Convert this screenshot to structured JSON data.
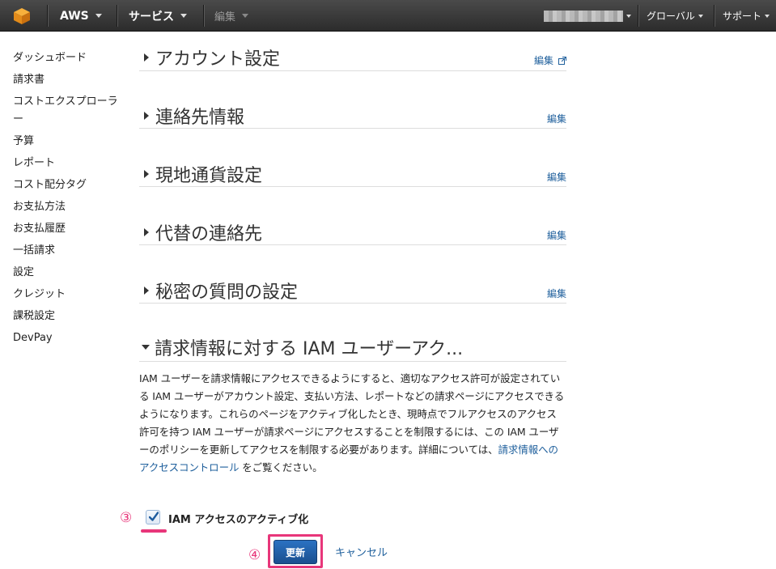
{
  "nav": {
    "brand": "AWS",
    "services": "サービス",
    "edit": "編集",
    "region": "グローバル",
    "support": "サポート"
  },
  "sidebar": {
    "items": [
      {
        "label": "ダッシュボード"
      },
      {
        "label": "請求書"
      },
      {
        "label": "コストエクスプローラー"
      },
      {
        "label": "予算"
      },
      {
        "label": "レポート"
      },
      {
        "label": "コスト配分タグ"
      },
      {
        "label": "お支払方法"
      },
      {
        "label": "お支払履歴"
      },
      {
        "label": "一括請求"
      },
      {
        "label": "設定"
      },
      {
        "label": "クレジット"
      },
      {
        "label": "課税設定"
      },
      {
        "label": "DevPay"
      }
    ]
  },
  "sections": [
    {
      "title": "アカウント設定",
      "edit": "編集"
    },
    {
      "title": "連絡先情報",
      "edit": "編集"
    },
    {
      "title": "現地通貨設定",
      "edit": "編集"
    },
    {
      "title": "代替の連絡先",
      "edit": "編集"
    },
    {
      "title": "秘密の質問の設定",
      "edit": "編集"
    }
  ],
  "iam": {
    "title": "請求情報に対する IAM ユーザーアク...",
    "text_before": "IAM ユーザーを請求情報にアクセスできるようにすると、適切なアクセス許可が設定されている IAM ユーザーがアカウント設定、支払い方法、レポートなどの請求ページにアクセスできるようになります。これらのページをアクティブ化したとき、現時点でフルアクセスのアクセス許可を持つ IAM ユーザーが請求ページにアクセスすることを制限するには、この IAM ユーザーのポリシーを更新してアクセスを制限する必要があります。詳細については、",
    "link": "請求情報へのアクセスコントロール",
    "text_after": " をご覧ください。",
    "checkbox_label": "IAM アクセスのアクティブ化",
    "checkbox_checked": true,
    "update_button": "更新",
    "cancel_link": "キャンセル"
  },
  "annotations": {
    "step3": "③",
    "step4": "④"
  },
  "colors": {
    "accent": "#e8367a",
    "link": "#1e5f9c",
    "button": "#1a4f8f"
  }
}
